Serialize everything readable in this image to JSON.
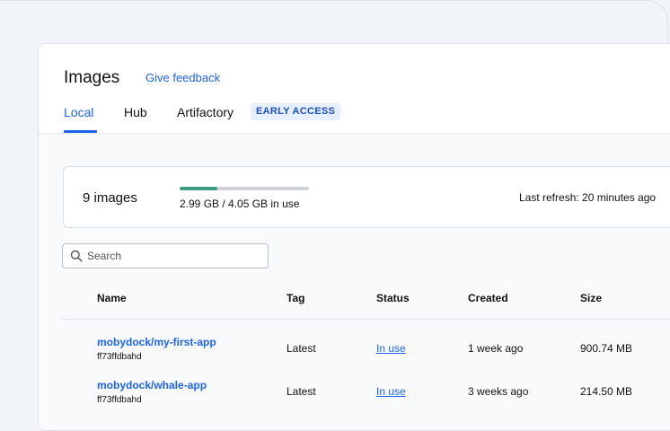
{
  "page": {
    "title": "Images",
    "feedback_link": "Give feedback",
    "tabs": [
      {
        "label": "Local",
        "active": true
      },
      {
        "label": "Hub",
        "active": false
      },
      {
        "label": "Artifactory",
        "active": false
      }
    ],
    "badge": "EARLY ACCESS"
  },
  "summary": {
    "count": "9 images",
    "usage_text": "2.99 GB / 4.05 GB in use",
    "usage_fraction": 0.29,
    "last_refresh": "Last refresh: 20 minutes ago"
  },
  "search": {
    "placeholder": "Search",
    "value": ""
  },
  "table": {
    "columns": [
      "Name",
      "Tag",
      "Status",
      "Created",
      "Size"
    ],
    "rows": [
      {
        "name": "mobydock/my-first-app",
        "id": "ff73ffdbahd",
        "tag": "Latest",
        "status": "In use",
        "created": "1 week ago",
        "size": "900.74 MB"
      },
      {
        "name": "mobydock/whale-app",
        "id": "ff73ffdbahd",
        "tag": "Latest",
        "status": "In use",
        "created": "3 weeks ago",
        "size": "214.50 MB"
      }
    ]
  },
  "colors": {
    "accent": "#1d63ed",
    "usage_bar": "#3a9c83",
    "badge_bg": "#e5efff"
  },
  "icons": {
    "search": "search-icon"
  }
}
